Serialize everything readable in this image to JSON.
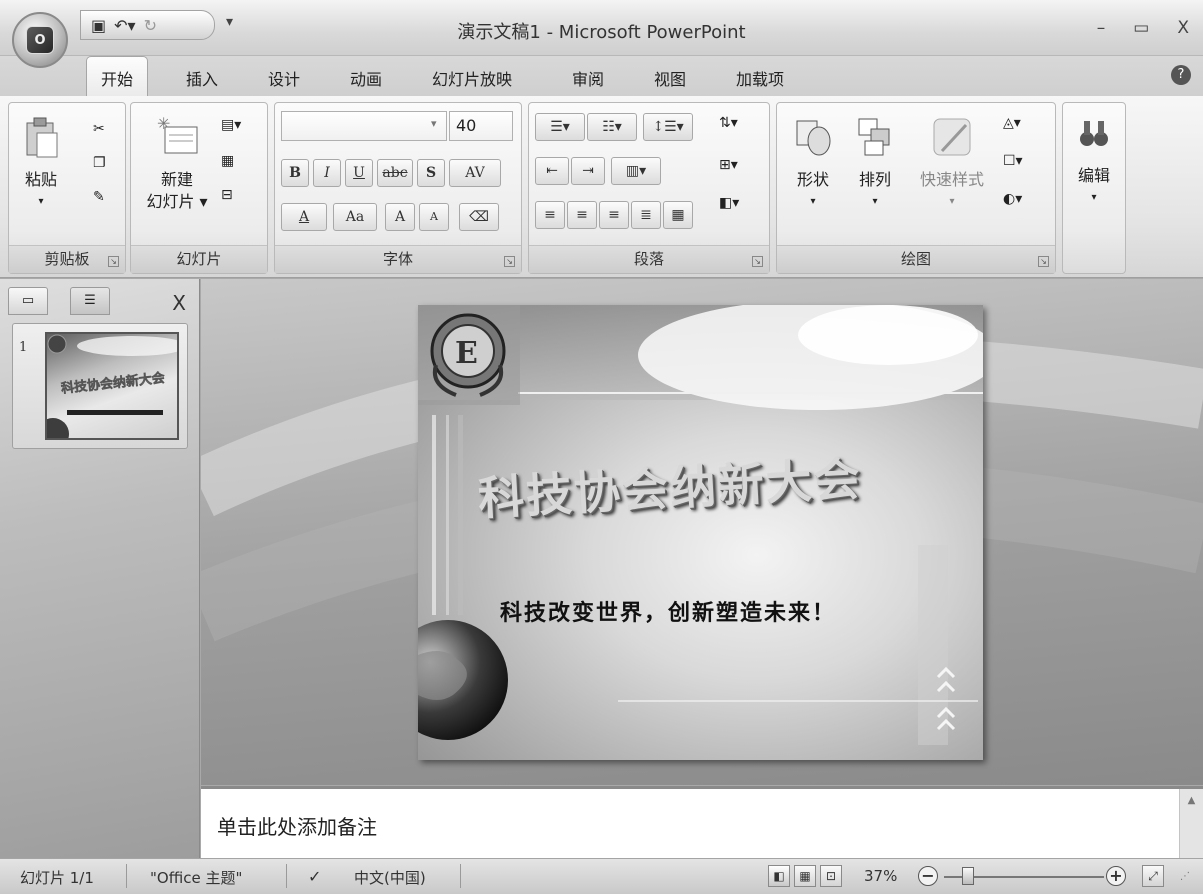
{
  "app": {
    "window_title": "演示文稿1 - Microsoft PowerPoint",
    "minimize": "–",
    "maximize": "▭",
    "close": "X"
  },
  "tabs": [
    "开始",
    "插入",
    "设计",
    "动画",
    "幻灯片放映",
    "审阅",
    "视图",
    "加载项"
  ],
  "ribbon": {
    "clipboard": {
      "label": "剪贴板",
      "paste": "粘贴"
    },
    "slides": {
      "label": "幻灯片",
      "new_slide_line1": "新建",
      "new_slide_line2": "幻灯片 ▾"
    },
    "font": {
      "label": "字体",
      "font_name": "",
      "font_size": "40",
      "bold": "B",
      "italic": "I",
      "underline": "U",
      "strike": "abc",
      "shadow": "S",
      "spacing": "AV",
      "color": "A",
      "case": "Aa",
      "grow": "A",
      "shrink": "A"
    },
    "paragraph": {
      "label": "段落"
    },
    "drawing": {
      "label": "绘图",
      "shapes": "形状",
      "arrange": "排列",
      "quick_styles": "快速样式"
    },
    "editing": {
      "label": "编辑"
    }
  },
  "slides_pane": {
    "slide_number": "1",
    "close": "X"
  },
  "slide": {
    "title": "科技协会纳新大会",
    "subtitle": "科技改变世界，创新塑造未来！"
  },
  "notes": {
    "placeholder": "单击此处添加备注"
  },
  "status": {
    "slide_info": "幻灯片 1/1",
    "theme": "\"Office 主题\"",
    "language": "中文(中国)",
    "zoom": "37%",
    "zoom_level": 0.37
  }
}
